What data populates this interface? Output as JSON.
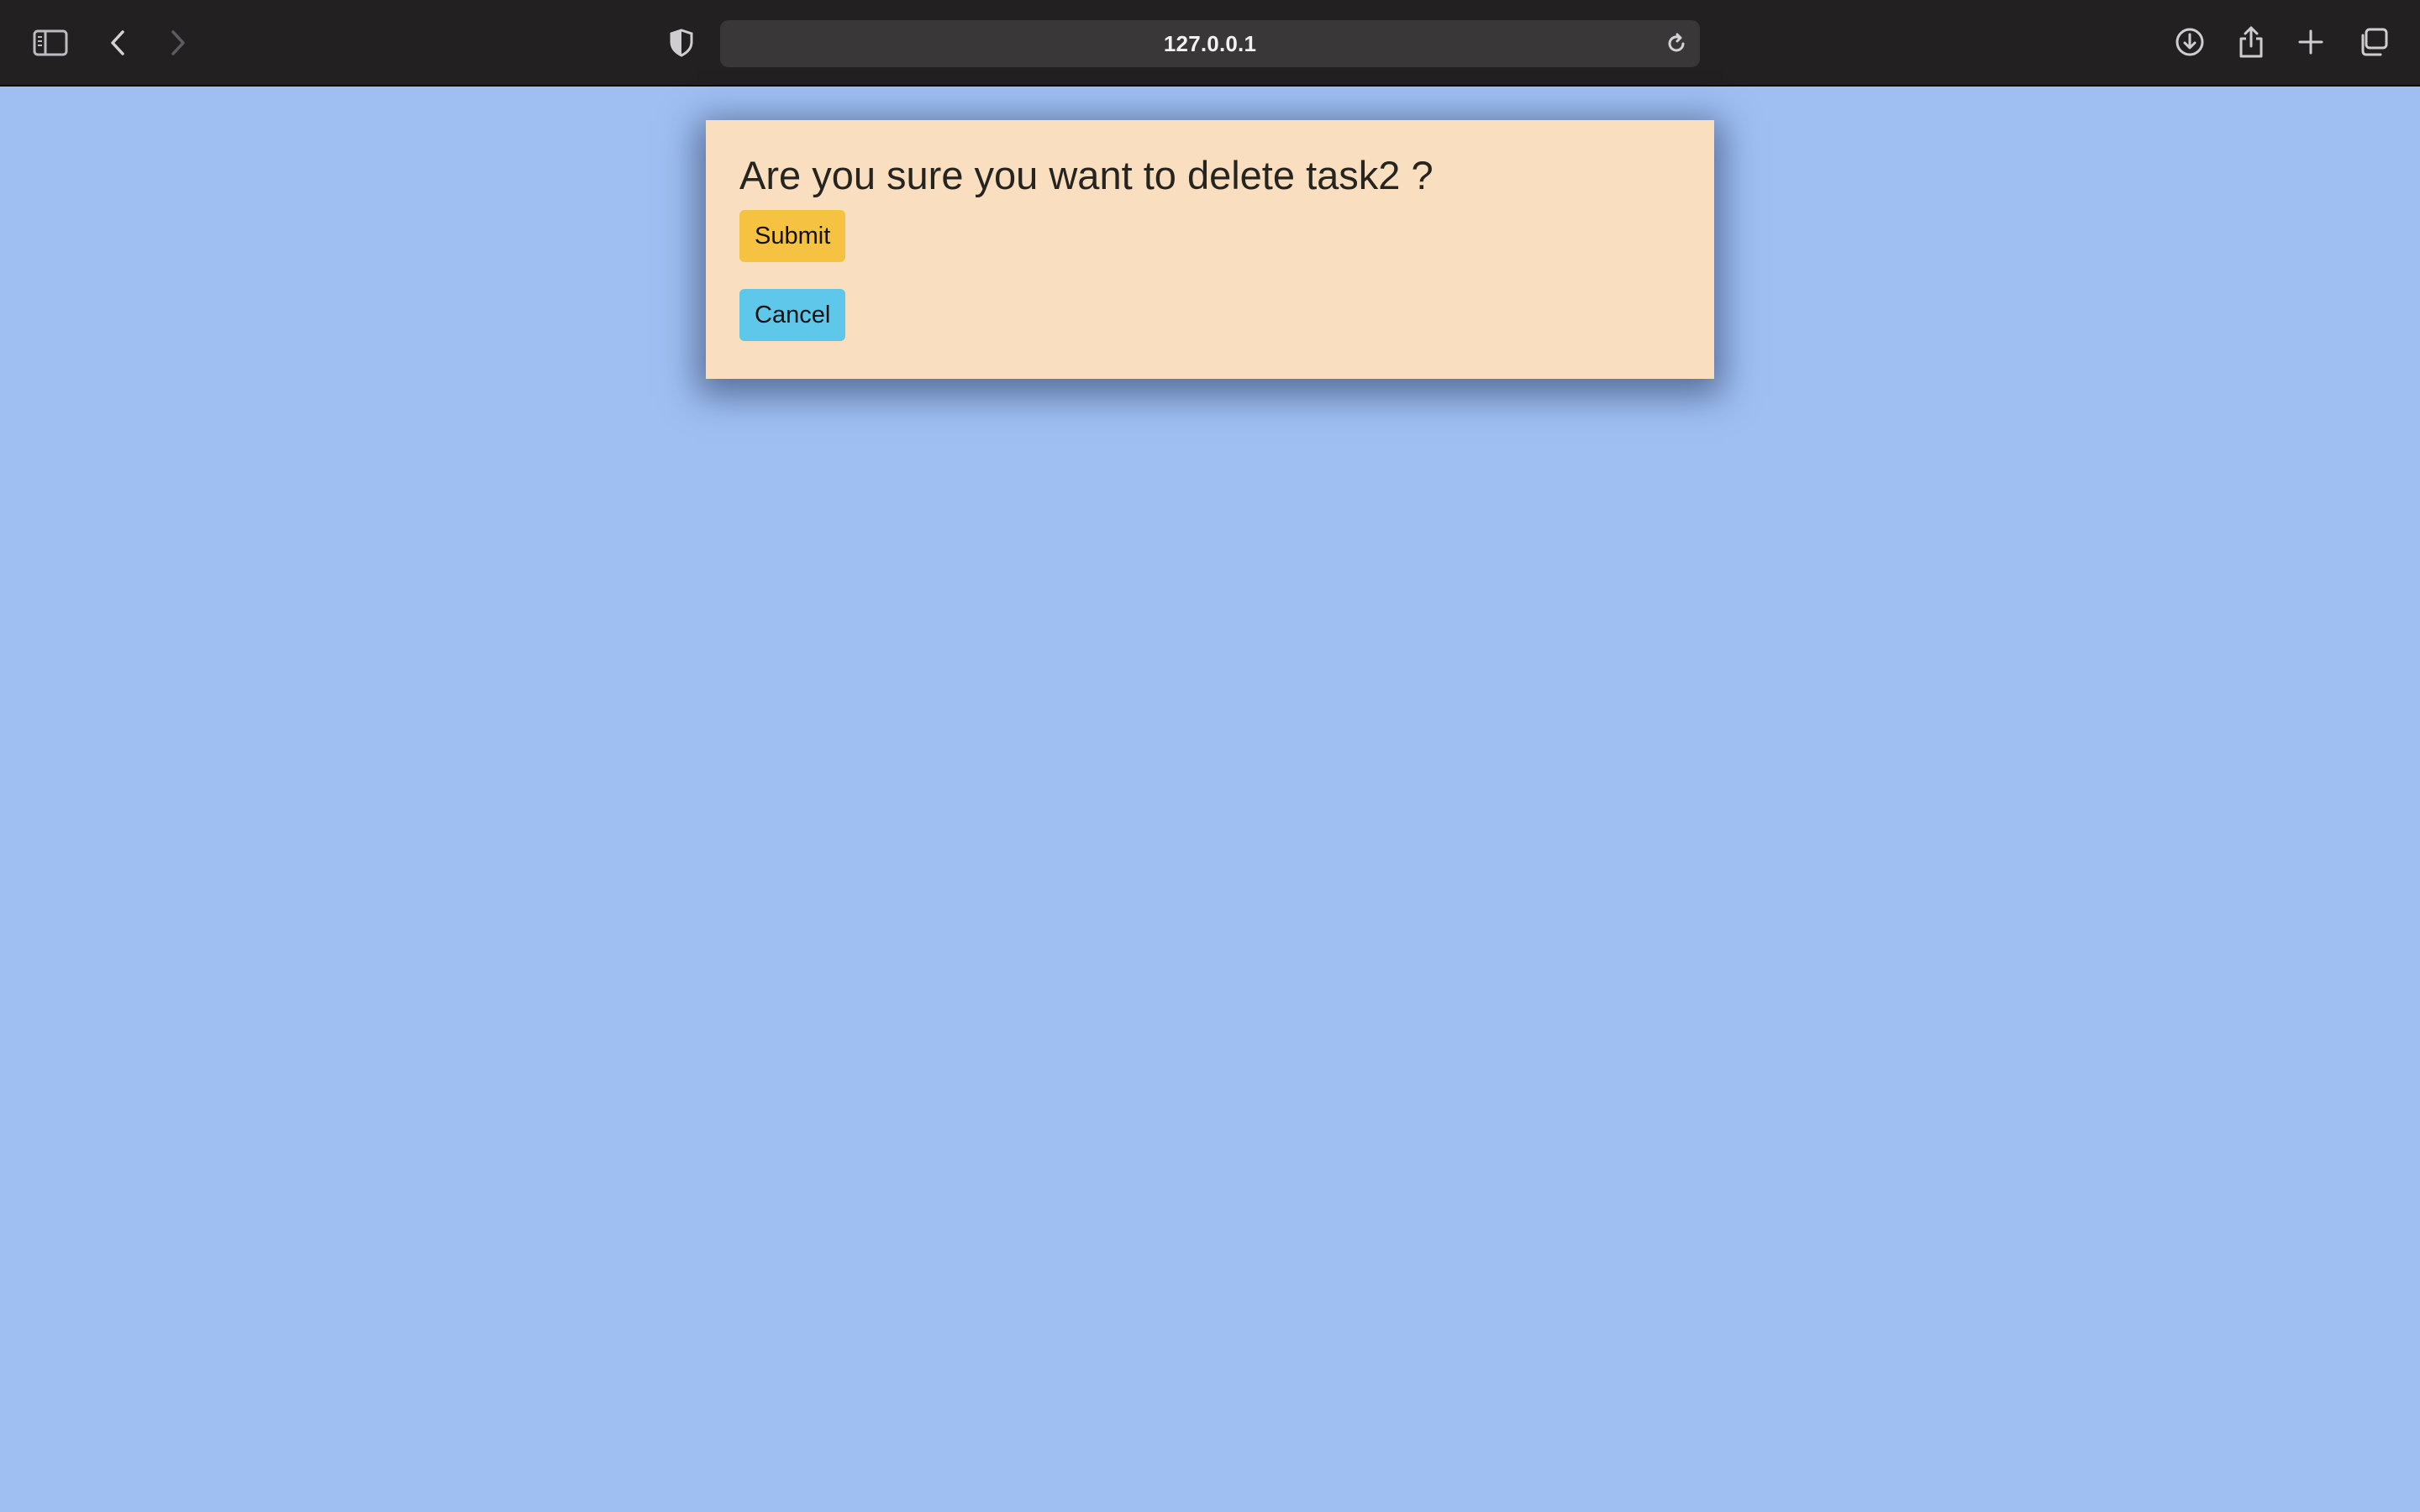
{
  "browser": {
    "url": "127.0.0.1",
    "icons": {
      "sidebar": "sidebar-icon",
      "back": "chevron-left-icon",
      "forward": "chevron-right-icon",
      "privacy": "shield-icon",
      "reload": "reload-icon",
      "downloads": "download-icon",
      "share": "share-icon",
      "new_tab": "plus-icon",
      "tabs": "tab-overview-icon"
    },
    "colors": {
      "toolbar": "#232022",
      "url_bar": "#3a3739"
    }
  },
  "page": {
    "background": "#9fbff3",
    "dialog": {
      "title": "Are you sure you want to delete task2 ?",
      "submit_label": "Submit",
      "cancel_label": "Cancel",
      "background": "#fadec0",
      "submit_color": "#f5c242",
      "cancel_color": "#5fc7ea"
    }
  }
}
